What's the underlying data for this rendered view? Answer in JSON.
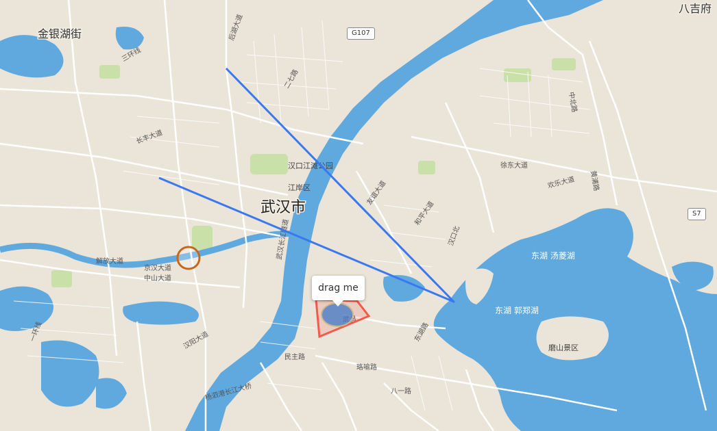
{
  "map": {
    "city_label": "武汉市",
    "district_labels": [
      "金银湖街",
      "八吉府"
    ],
    "area_labels": [
      "江岸区",
      "汉口江滩公园",
      "磨山景区"
    ],
    "lake_labels": [
      "东湖 汤菱湖",
      "东湖 郭郑湖"
    ],
    "road_shields": [
      "G107",
      "S7"
    ],
    "street_labels": [
      "后湖大道",
      "三环线",
      "长丰大道",
      "解放大道",
      "中山大道",
      "京汉大道",
      "汉阳大道",
      "武昌",
      "友谊大道",
      "和平大道",
      "徐东大道",
      "欢乐大道",
      "汉口北",
      "黄浦路",
      "二七路",
      "一环线",
      "民主路",
      "八一路",
      "中北路",
      "东湖路",
      "珞喻路",
      "武汉长江隧道",
      "杨泗港长江大桥"
    ]
  },
  "popup": {
    "text": "drag me"
  },
  "colors": {
    "water": "#5fa9de",
    "land": "#ebe4d8",
    "park": "#c9e0a8",
    "line": "#3a78f2",
    "polygon": "#f25a4b",
    "circle": "#c8661b",
    "vertex": "#4078c8"
  }
}
